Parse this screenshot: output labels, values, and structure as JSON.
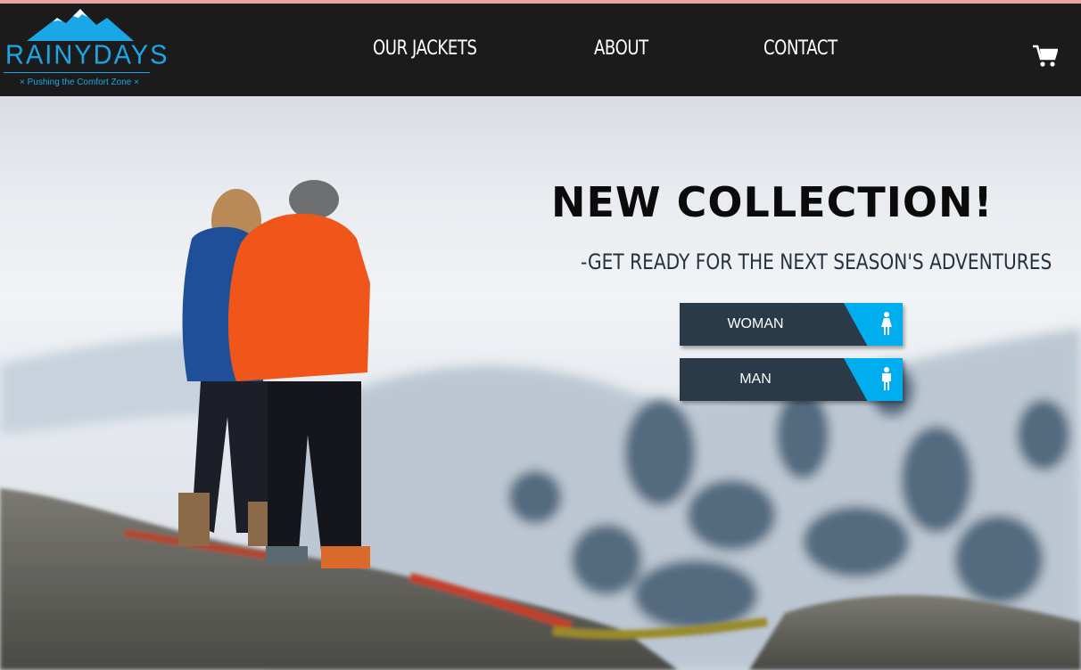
{
  "header": {
    "logo_text": "RAINYDAYS",
    "tagline": "× Pushing the Comfort Zone ×",
    "nav": [
      "OUR JACKETS",
      "ABOUT",
      "CONTACT"
    ],
    "cart_icon": "cart-icon"
  },
  "hero": {
    "title": "NEW COLLECTION!",
    "subtitle": "-GET READY FOR THE NEXT SEASON'S ADVENTURES",
    "buttons": [
      {
        "label": "WOMAN",
        "icon": "female-person-icon"
      },
      {
        "label": "MAN",
        "icon": "male-person-icon"
      }
    ]
  },
  "colors": {
    "navbar": "#1b1b1b",
    "accent": "#00aeef",
    "logo": "#1aa7e8",
    "button": "#2b3a49"
  }
}
